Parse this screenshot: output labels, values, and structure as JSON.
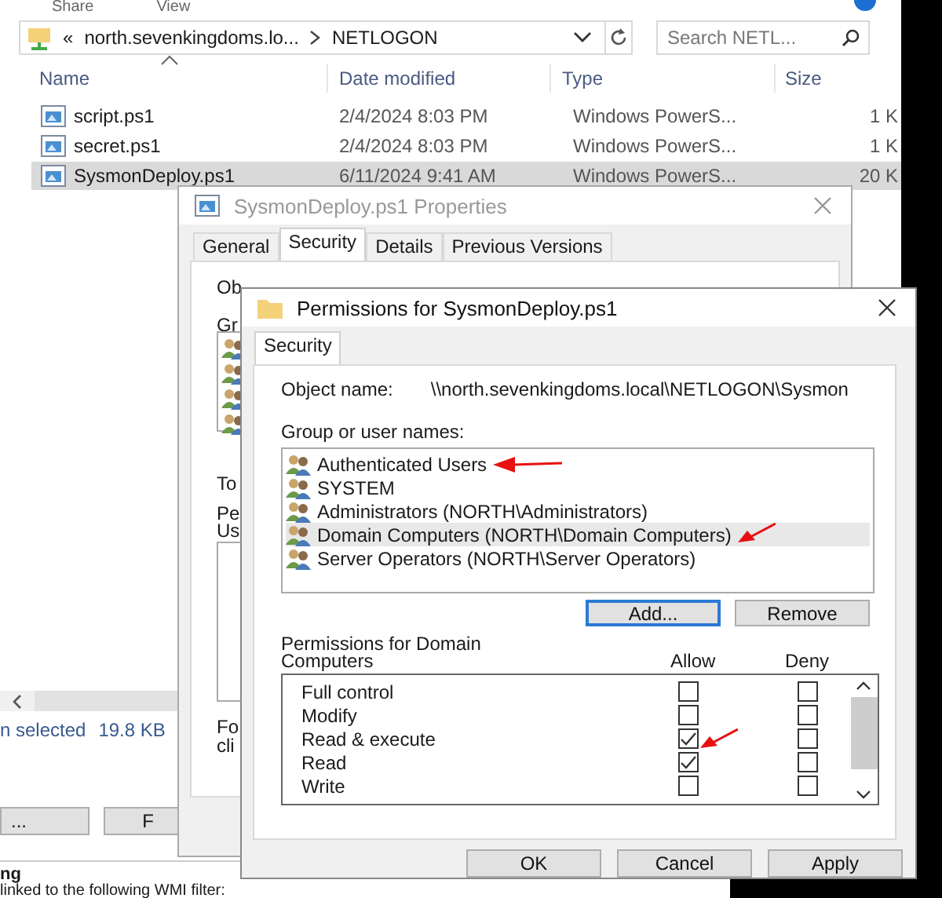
{
  "explorer": {
    "ribbon_tabs": [
      "Share",
      "View"
    ],
    "breadcrumb": [
      "«",
      "north.sevenkingdoms.lo...",
      "NETLOGON"
    ],
    "search": {
      "placeholder": "Search NETL..."
    },
    "columns": [
      "Name",
      "Date modified",
      "Type",
      "Size"
    ],
    "files": [
      {
        "name": "script.ps1",
        "date": "2/4/2024 8:03 PM",
        "type": "Windows PowerS...",
        "size": "1 K",
        "selected": false
      },
      {
        "name": "secret.ps1",
        "date": "2/4/2024 8:03 PM",
        "type": "Windows PowerS...",
        "size": "1 K",
        "selected": false
      },
      {
        "name": "SysmonDeploy.ps1",
        "date": "6/11/2024 9:41 AM",
        "type": "Windows PowerS...",
        "size": "20 K",
        "selected": true
      }
    ],
    "status": "n selected",
    "status_size": "19.8 KB",
    "buttons": [
      "...",
      "F"
    ]
  },
  "properties": {
    "title": "SysmonDeploy.ps1 Properties",
    "tabs": [
      {
        "label": "General",
        "selected": false
      },
      {
        "label": "Security",
        "selected": true
      },
      {
        "label": "Details",
        "selected": false
      },
      {
        "label": "Previous Versions",
        "selected": false
      }
    ],
    "labels": [
      "Ob",
      "Gr",
      "To",
      "Pe",
      "Us",
      "Fo",
      "cli"
    ]
  },
  "permissions": {
    "title": "Permissions for SysmonDeploy.ps1",
    "tab": "Security",
    "object_label": "Object name:",
    "object_name": "\\\\north.sevenkingdoms.local\\NETLOGON\\Sysmon",
    "group_label": "Group or user names:",
    "principals": [
      {
        "name": "Authenticated Users",
        "selected": false,
        "annotated": true
      },
      {
        "name": "SYSTEM",
        "selected": false,
        "annotated": false
      },
      {
        "name": "Administrators (NORTH\\Administrators)",
        "selected": false,
        "annotated": false
      },
      {
        "name": "Domain Computers (NORTH\\Domain Computers)",
        "selected": true,
        "annotated": true
      },
      {
        "name": "Server Operators (NORTH\\Server Operators)",
        "selected": false,
        "annotated": false
      }
    ],
    "list_buttons": [
      "Add...",
      "Remove"
    ],
    "perm_label": "Permissions for Domain Computers",
    "allow_label": "Allow",
    "deny_label": "Deny",
    "rights": [
      {
        "name": "Full control",
        "allow": false,
        "deny": false,
        "annotated": false
      },
      {
        "name": "Modify",
        "allow": false,
        "deny": false,
        "annotated": false
      },
      {
        "name": "Read & execute",
        "allow": true,
        "deny": false,
        "annotated": true
      },
      {
        "name": "Read",
        "allow": true,
        "deny": false,
        "annotated": false
      },
      {
        "name": "Write",
        "allow": false,
        "deny": false,
        "annotated": false
      }
    ],
    "footer_buttons": [
      "OK",
      "Cancel",
      "Apply"
    ]
  },
  "lower_window": {
    "heading": "ng",
    "text": "linked to the following WMI filter:"
  }
}
